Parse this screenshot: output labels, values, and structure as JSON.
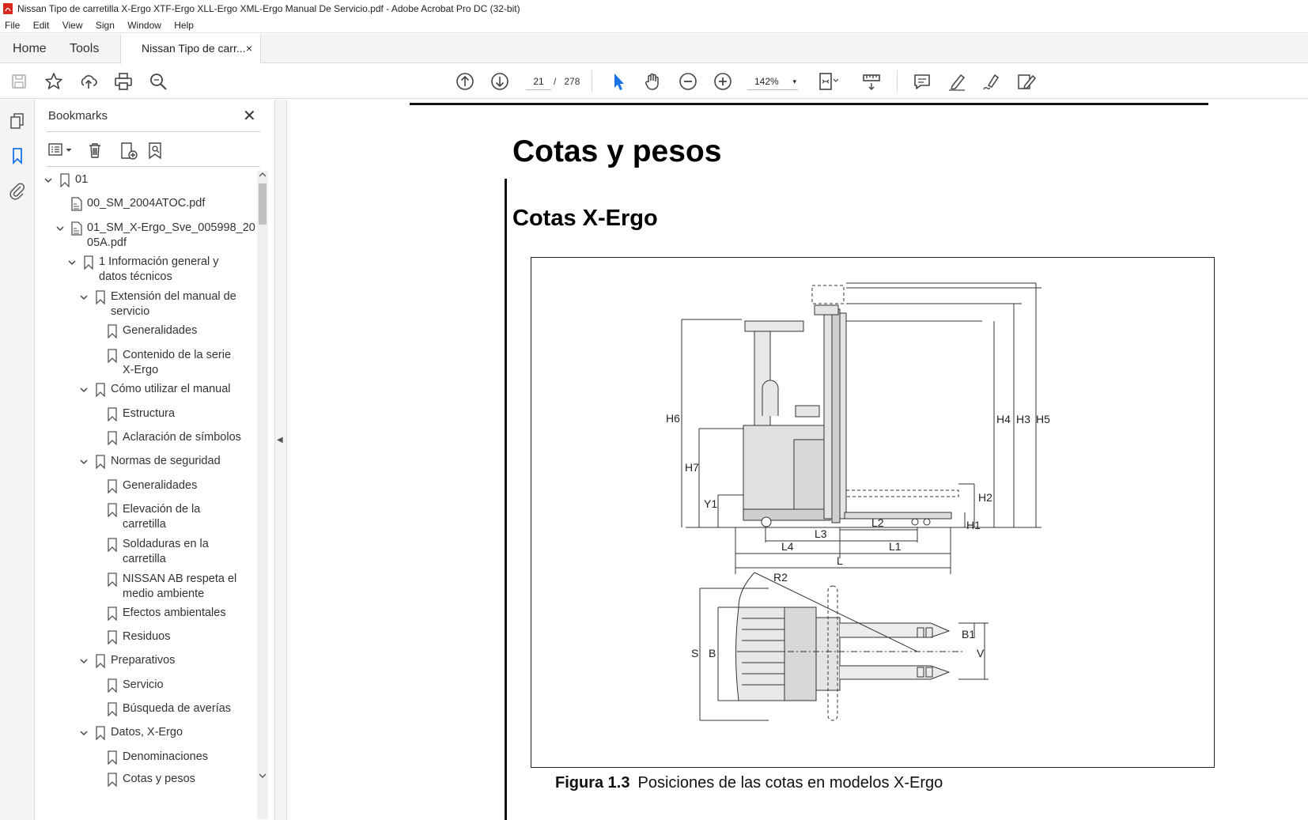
{
  "window": {
    "title": "Nissan Tipo de carretilla X-Ergo XTF-Ergo XLL-Ergo XML-Ergo Manual De Servicio.pdf - Adobe Acrobat Pro DC (32-bit)",
    "pdf_icon": "pdf-icon"
  },
  "menu": [
    "File",
    "Edit",
    "View",
    "Sign",
    "Window",
    "Help"
  ],
  "tabs": {
    "home": "Home",
    "tools": "Tools",
    "document": "Nissan Tipo de carr...",
    "close": "×"
  },
  "toolbar": {
    "page_current": "21",
    "page_separator": "/",
    "page_total": "278",
    "zoom": "142%",
    "caret": "▾",
    "icons": [
      "save-icon",
      "star-icon",
      "upload-icon",
      "print-icon",
      "search-zoom-icon",
      "prev-page-icon",
      "next-page-icon",
      "select-cursor-icon",
      "hand-icon",
      "zoom-out-icon",
      "zoom-in-icon",
      "fit-page-icon",
      "measure-icon",
      "comment-icon",
      "highlight-icon",
      "sign-icon",
      "edit-icon"
    ]
  },
  "sidebar": {
    "title": "Bookmarks",
    "close": "✕",
    "collapse_arrow": "◀",
    "bookmarks": [
      {
        "label": "01",
        "expanded": true,
        "icon": "bookmark-icon"
      },
      {
        "label": "00_SM_2004ATOC.pdf",
        "icon": "pdf-file-icon"
      },
      {
        "label": "01_SM_X-Ergo_Sve_005998_20",
        "label2": "05A.pdf",
        "expanded": true,
        "icon": "pdf-file-icon"
      },
      {
        "label": "1 Información general y",
        "label2": "datos técnicos",
        "expanded": true,
        "icon": "bookmark-icon"
      },
      {
        "label": "Extensión del manual de",
        "label2": "servicio",
        "expanded": true,
        "icon": "bookmark-icon"
      },
      {
        "label": "Generalidades",
        "icon": "bookmark-icon"
      },
      {
        "label": "Contenido de la serie",
        "label2": "X-Ergo",
        "icon": "bookmark-icon"
      },
      {
        "label": "Cómo utilizar el manual",
        "expanded": true,
        "icon": "bookmark-icon"
      },
      {
        "label": "Estructura",
        "icon": "bookmark-icon"
      },
      {
        "label": "Aclaración de símbolos",
        "icon": "bookmark-icon"
      },
      {
        "label": "Normas de seguridad",
        "expanded": true,
        "icon": "bookmark-icon"
      },
      {
        "label": "Generalidades",
        "icon": "bookmark-icon"
      },
      {
        "label": "Elevación de la",
        "label2": "carretilla",
        "icon": "bookmark-icon"
      },
      {
        "label": "Soldaduras en la",
        "label2": "carretilla",
        "icon": "bookmark-icon"
      },
      {
        "label": "NISSAN AB respeta el",
        "label2": "medio ambiente",
        "icon": "bookmark-icon"
      },
      {
        "label": "Efectos ambientales",
        "icon": "bookmark-icon"
      },
      {
        "label": "Residuos",
        "icon": "bookmark-icon"
      },
      {
        "label": "Preparativos",
        "expanded": true,
        "icon": "bookmark-icon"
      },
      {
        "label": "Servicio",
        "icon": "bookmark-icon"
      },
      {
        "label": "Búsqueda de averías",
        "icon": "bookmark-icon"
      },
      {
        "label": "Datos, X-Ergo",
        "expanded": true,
        "icon": "bookmark-icon"
      },
      {
        "label": "Denominaciones",
        "icon": "bookmark-icon"
      },
      {
        "label": "Cotas y pesos",
        "icon": "bookmark-icon"
      }
    ]
  },
  "document": {
    "heading1": "Cotas y pesos",
    "heading2": "Cotas X-Ergo",
    "figure_labels": {
      "H6": "H6",
      "H7": "H7",
      "Y1": "Y1",
      "H4": "H4",
      "H3": "H3",
      "H5": "H5",
      "H2": "H2",
      "H1": "H1",
      "L2": "L2",
      "L3": "L3",
      "L4": "L4",
      "L1": "L1",
      "L": "L",
      "R2": "R2",
      "S": "S",
      "B": "B",
      "B1": "B1",
      "V": "V"
    },
    "caption_number": "Figura 1.3",
    "caption_text": "Posiciones de las cotas en modelos X-Ergo"
  }
}
